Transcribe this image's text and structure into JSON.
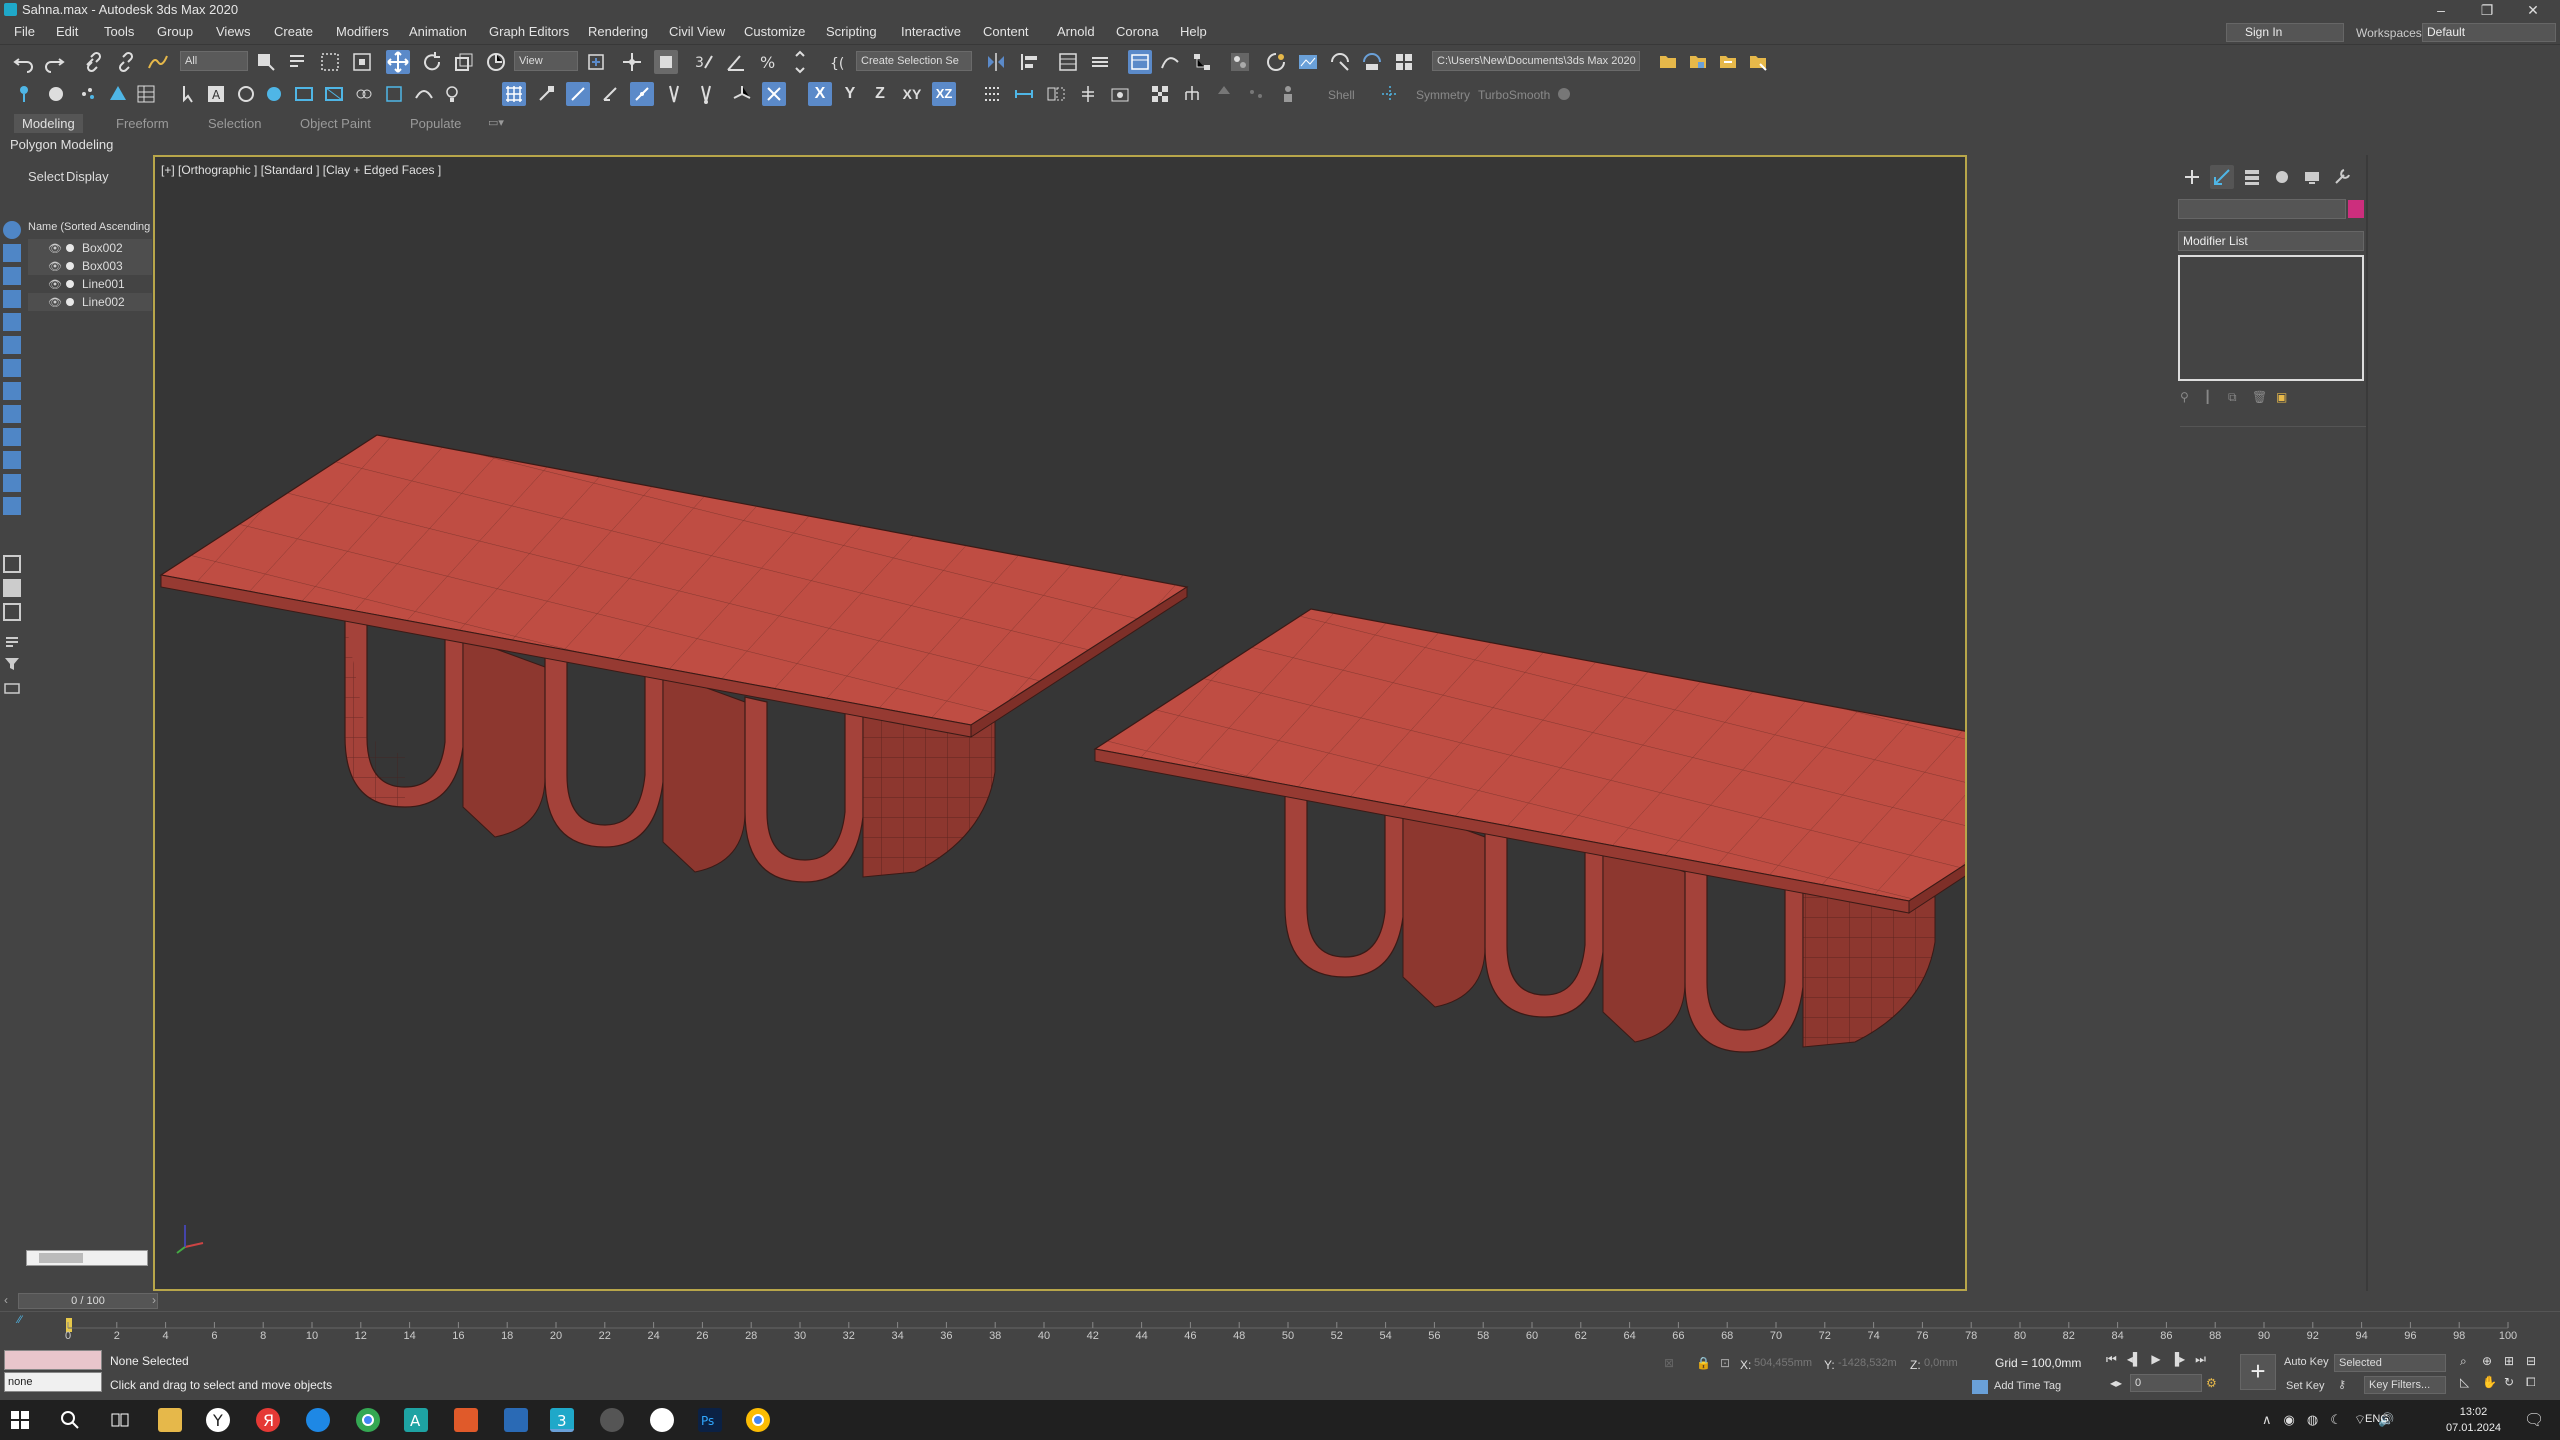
{
  "window": {
    "title": "Sahna.max - Autodesk 3ds Max 2020",
    "min": "–",
    "restore": "❐",
    "close": "✕"
  },
  "menu": [
    "File",
    "Edit",
    "Tools",
    "Group",
    "Views",
    "Create",
    "Modifiers",
    "Animation",
    "Graph Editors",
    "Rendering",
    "Civil View",
    "Customize",
    "Scripting",
    "Interactive",
    "Content",
    "Arnold",
    "Corona",
    "Help"
  ],
  "account": {
    "signin": "Sign In",
    "workspaces_label": "Workspaces:",
    "workspace": "Default"
  },
  "toolbar": {
    "filter": "All",
    "ref_coord": "View",
    "selection_set": "Create Selection Se",
    "project_path": "C:\\Users\\New\\Documents\\3ds Max 2020",
    "axis_x": "X",
    "axis_y": "Y",
    "axis_z": "Z",
    "axis_xy": "XY",
    "axis_xz": "XZ",
    "shell": "Shell",
    "symmetry": "Symmetry",
    "turbosmooth": "TurboSmooth"
  },
  "ribbon": {
    "tabs": [
      "Modeling",
      "Freeform",
      "Selection",
      "Object Paint",
      "Populate"
    ],
    "active": "Modeling",
    "panel": "Polygon Modeling"
  },
  "explorer": {
    "tab_select": "Select",
    "tab_display": "Display",
    "column": "Name (Sorted Ascending",
    "objects": [
      {
        "name": "Box002",
        "selected": true
      },
      {
        "name": "Box003",
        "selected": true
      },
      {
        "name": "Line001",
        "selected": false
      },
      {
        "name": "Line002",
        "selected": true
      }
    ]
  },
  "viewport": {
    "label": "[+] [Orthographic ] [Standard ] [Clay + Edged Faces ]",
    "object_color": "#b84a40",
    "wire_color": "#3a1a16"
  },
  "command_panel": {
    "modifier_list": "Modifier List",
    "object_color": "#cc2e7d"
  },
  "timeline": {
    "frame": "0 / 100",
    "ticks": [
      "0",
      "2",
      "4",
      "6",
      "8",
      "10",
      "12",
      "14",
      "16",
      "18",
      "20",
      "22",
      "24",
      "26",
      "28",
      "30",
      "32",
      "34",
      "36",
      "38",
      "40",
      "42",
      "44",
      "46",
      "48",
      "50",
      "52",
      "54",
      "56",
      "58",
      "60",
      "62",
      "64",
      "66",
      "68",
      "70",
      "72",
      "74",
      "76",
      "78",
      "80",
      "82",
      "84",
      "86",
      "88",
      "90",
      "92",
      "94",
      "96",
      "98",
      "100"
    ]
  },
  "status": {
    "maxscript_value": "none",
    "selection": "None Selected",
    "prompt": "Click and drag to select and move objects",
    "x_label": "X:",
    "x_val": "504,455mm",
    "y_label": "Y:",
    "y_val": "-1428,532m",
    "z_label": "Z:",
    "z_val": "0,0mm",
    "grid": "Grid = 100,0mm",
    "add_time_tag": "Add Time Tag",
    "auto_key": "Auto Key",
    "set_key": "Set Key",
    "key_mode": "Selected",
    "key_filters": "Key Filters...",
    "current_frame": "0"
  },
  "taskbar": {
    "lang": "ENG",
    "time": "13:02",
    "date": "07.01.2024"
  }
}
